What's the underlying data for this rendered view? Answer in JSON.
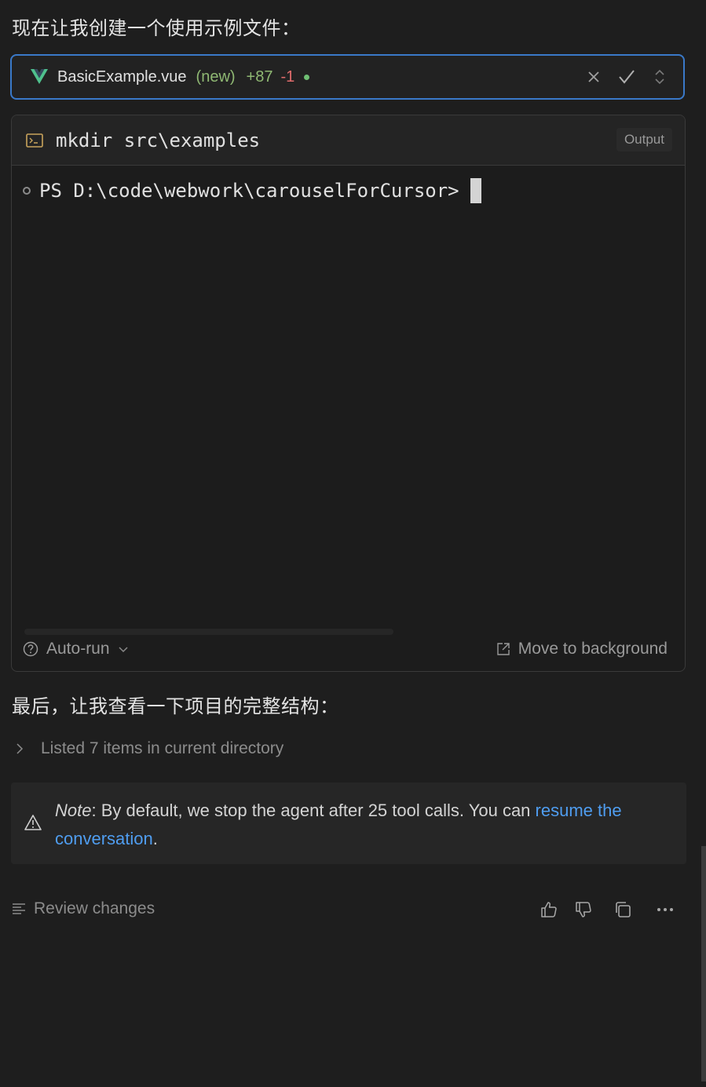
{
  "messages": {
    "create_example": "现在让我创建一个使用示例文件：",
    "view_structure": "最后，让我查看一下项目的完整结构："
  },
  "file_change": {
    "name": "BasicExample.vue",
    "status": "(new)",
    "additions": "+87",
    "deletions": "-1",
    "icons": {
      "file": "vue-icon",
      "reject": "close-icon",
      "accept": "check-icon",
      "expand": "chevron-updown-icon"
    },
    "colors": {
      "border": "#3a79c9",
      "additions": "#8fb873",
      "deletions": "#e06c6c"
    }
  },
  "terminal": {
    "command": "mkdir src\\examples",
    "output_label": "Output",
    "prompt": "PS D:\\code\\webwork\\carouselForCursor>",
    "auto_run_label": "Auto-run",
    "move_bg_label": "Move to background",
    "icons": {
      "terminal": "terminal-icon",
      "auto_run": "question-circle-icon",
      "dropdown": "chevron-down-icon",
      "move_bg": "external-link-icon"
    }
  },
  "listing": {
    "label": "Listed 7 items in current directory",
    "icon": "chevron-right-icon"
  },
  "note": {
    "label": "Note",
    "text": ": By default, we stop the agent after 25 tool calls. You can ",
    "link": "resume the conversation",
    "end": ".",
    "icon": "warning-icon",
    "link_color": "#4f9df0"
  },
  "footer": {
    "review_label": "Review changes",
    "icons": {
      "review": "list-icon",
      "like": "thumbs-up-icon",
      "dislike": "thumbs-down-icon",
      "copy": "copy-icon",
      "more": "more-icon"
    }
  }
}
